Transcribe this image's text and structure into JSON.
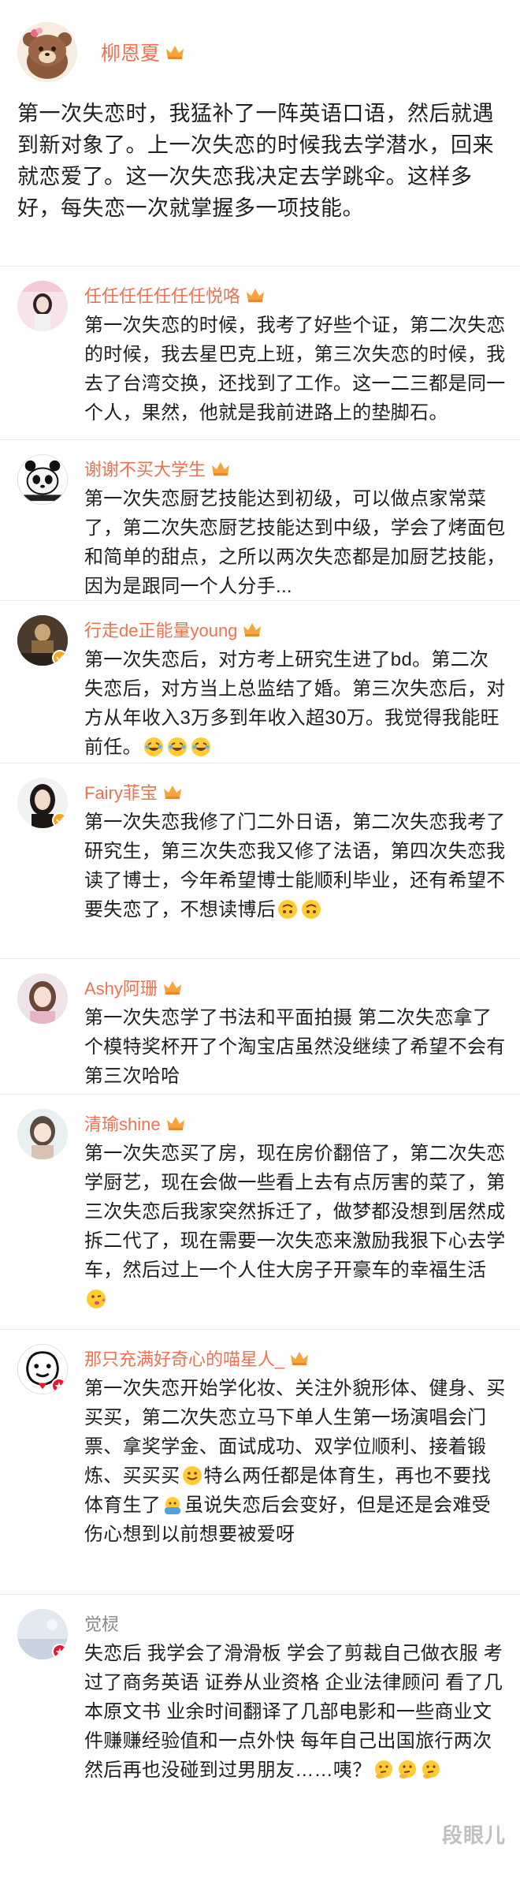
{
  "post": {
    "username": "柳恩夏",
    "text": "第一次失恋时，我猛补了一阵英语口语，然后就遇到新对象了。上一次失恋的时候我去学潜水，回来就恋爱了。这一次失恋我决定去学跳伞。这样多好，每失恋一次就掌握多一项技能。"
  },
  "comments": [
    {
      "username": "任任任任任任任悦咯",
      "text": "第一次失恋的时候，我考了好些个证，第二次失恋的时候，我去星巴克上班，第三次失恋的时候，我去了台湾交换，还找到了工作。这一二三都是同一个人，果然，他就是我前进路上的垫脚石。"
    },
    {
      "username": "谢谢不买大学生",
      "text": "第一次失恋厨艺技能达到初级，可以做点家常菜了，第二次失恋厨艺技能达到中级，学会了烤面包和简单的甜点，之所以两次失恋都是加厨艺技能，因为是跟同一个人分手..."
    },
    {
      "username": "行走de正能量young",
      "text": "第一次失恋后，对方考上研究生进了bd。第二次失恋后，对方当上总监结了婚。第三次失恋后，对方从年收入3万多到年收入超30万。我觉得我能旺前任。"
    },
    {
      "username": "Fairy菲宝",
      "text": "第一次失恋我修了门二外日语，第二次失恋我考了研究生，第三次失恋我又修了法语，第四次失恋我读了博士，今年希望博士能顺利毕业，还有希望不要失恋了，不想读博后"
    },
    {
      "username": "Ashy阿珊",
      "text": "第一次失恋学了书法和平面拍摄 第二次失恋拿了个模特奖杯开了个淘宝店虽然没继续了希望不会有第三次哈哈"
    },
    {
      "username": "清瑜shine",
      "text": "第一次失恋买了房，现在房价翻倍了，第二次失恋学厨艺，现在会做一些看上去有点厉害的菜了，第三次失恋后我家突然拆迁了，做梦都没想到居然成拆二代了，现在需要一次失恋来激励我狠下心去学车，然后过上一个人住大房子开豪车的幸福生活"
    },
    {
      "username": "那只充满好奇心的喵星人_",
      "text_a": "第一次失恋开始学化妆、关注外貌形体、健身、买买买，第二次失恋立马下单人生第一场演唱会门票、拿奖学金、面试成功、双学位顺利、接着锻炼、买买买",
      "text_b": "特么两任都是体育生，再也不要找体育生了",
      "text_c": "虽说失恋后会变好，但是还是会难受伤心想到以前想要被爱呀"
    },
    {
      "username": "觉棂",
      "text": "失恋后 我学会了滑滑板 学会了剪裁自己做衣服 考过了商务英语 证券从业资格 企业法律顾问 看了几本原文书 业余时间翻译了几部电影和一些商业文件赚赚经验值和一点外快 每年自己出国旅行两次 然后再也没碰到过男朋友……咦？"
    }
  ],
  "watermark": "段眼儿"
}
